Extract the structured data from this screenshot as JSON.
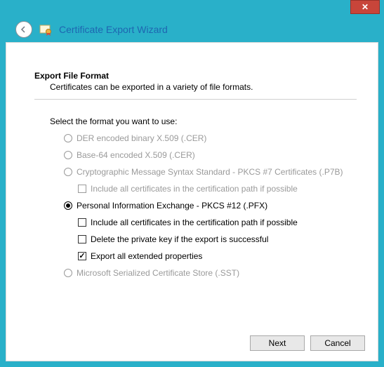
{
  "window": {
    "title": "Certificate Export Wizard"
  },
  "section": {
    "title": "Export File Format",
    "desc": "Certificates can be exported in a variety of file formats."
  },
  "prompt": "Select the format you want to use:",
  "options": {
    "der": "DER encoded binary X.509 (.CER)",
    "base64": "Base-64 encoded X.509 (.CER)",
    "p7b": "Cryptographic Message Syntax Standard - PKCS #7 Certificates (.P7B)",
    "p7b_include": "Include all certificates in the certification path if possible",
    "pfx": "Personal Information Exchange - PKCS #12 (.PFX)",
    "pfx_include": "Include all certificates in the certification path if possible",
    "pfx_delete": "Delete the private key if the export is successful",
    "pfx_ext": "Export all extended properties",
    "sst": "Microsoft Serialized Certificate Store (.SST)"
  },
  "buttons": {
    "next": "Next",
    "cancel": "Cancel"
  }
}
